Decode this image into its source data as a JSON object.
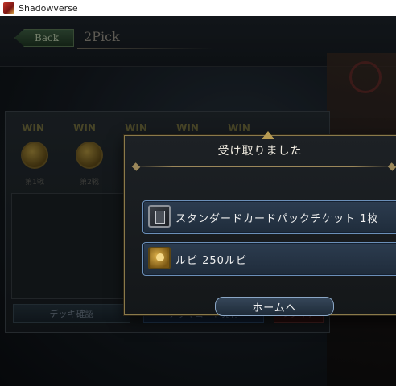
{
  "window": {
    "title": "Shadowverse"
  },
  "header": {
    "back_label": "Back",
    "page_title": "2Pick"
  },
  "progress": {
    "win_labels": [
      "WIN",
      "WIN",
      "WIN",
      "WIN",
      "WIN"
    ],
    "round_labels": [
      "第1戦",
      "第2戦"
    ]
  },
  "footer": {
    "deck_check_label": "デッキ確認",
    "deck_code_label": "デッキコード発行",
    "retire_label": "リタイア"
  },
  "modal": {
    "title": "受け取りました",
    "close_label": "×",
    "items": [
      {
        "icon": "card-pack-ticket-icon",
        "text": "スタンダードカードパックチケット 1枚"
      },
      {
        "icon": "rupee-icon",
        "text": "ルピ 250ルピ"
      }
    ],
    "home_label": "ホームへ"
  },
  "colors": {
    "modal_border": "#8b7a4a",
    "item_border": "#6b8fb8",
    "win_label": "#6f6a3c"
  }
}
